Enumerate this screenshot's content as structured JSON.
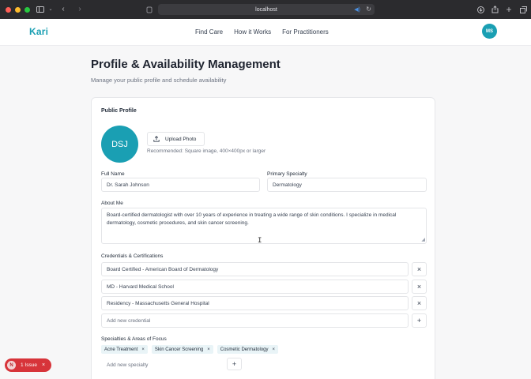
{
  "browser": {
    "url": "localhost",
    "colors": {
      "close": "#ff5f57",
      "minimize": "#febc2e",
      "zoom": "#28c840"
    }
  },
  "header": {
    "logo": "Kari",
    "nav": [
      "Find Care",
      "How it Works",
      "For Practitioners"
    ],
    "user_initials": "MS",
    "accent": "#1a9fb3"
  },
  "page": {
    "title": "Profile & Availability Management",
    "subtitle": "Manage your public profile and schedule availability"
  },
  "profile": {
    "section_title": "Public Profile",
    "avatar_initials": "DSJ",
    "upload_label": "Upload Photo",
    "upload_hint": "Recommended: Square image, 400×400px or larger",
    "full_name_label": "Full Name",
    "full_name": "Dr. Sarah Johnson",
    "specialty_label": "Primary Specialty",
    "specialty": "Dermatology",
    "about_label": "About Me",
    "about": "Board-certified dermatologist with over 10 years of experience in treating a wide range of skin conditions. I specialize in medical dermatology, cosmetic procedures, and skin cancer screening."
  },
  "credentials": {
    "label": "Credentials & Certifications",
    "items": [
      "Board Certified - American Board of Dermatology",
      "MD - Harvard Medical School",
      "Residency - Massachusetts General Hospital"
    ],
    "add_placeholder": "Add new credential"
  },
  "specialties": {
    "label": "Specialties & Areas of Focus",
    "items": [
      "Acne Treatment",
      "Skin Cancer Screening",
      "Cosmetic Dermatology"
    ],
    "add_placeholder": "Add new specialty"
  },
  "issues": {
    "badge": "N",
    "label": "1 Issue"
  }
}
